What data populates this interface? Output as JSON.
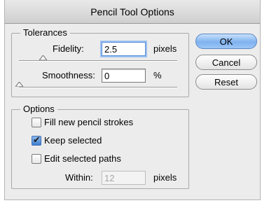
{
  "dialog": {
    "title": "Pencil Tool Options"
  },
  "tolerances": {
    "title": "Tolerances",
    "fidelity": {
      "label": "Fidelity:",
      "value": "2.5",
      "unit": "pixels",
      "slider_level": 0.15
    },
    "smoothness": {
      "label": "Smoothness:",
      "value": "0",
      "unit": "%",
      "slider_level": 0.0
    }
  },
  "options": {
    "title": "Options",
    "fill_new_strokes": {
      "label": "Fill new pencil strokes",
      "checked": false
    },
    "keep_selected": {
      "label": "Keep selected",
      "checked": true
    },
    "edit_selected_paths": {
      "label": "Edit selected paths",
      "checked": false
    },
    "within": {
      "label": "Within:",
      "value": "12",
      "unit": "pixels",
      "enabled": false
    }
  },
  "buttons": {
    "ok": "OK",
    "cancel": "Cancel",
    "reset": "Reset"
  },
  "colors": {
    "accent": "#7fb2ef",
    "focus_ring": "#9cc1f0"
  }
}
